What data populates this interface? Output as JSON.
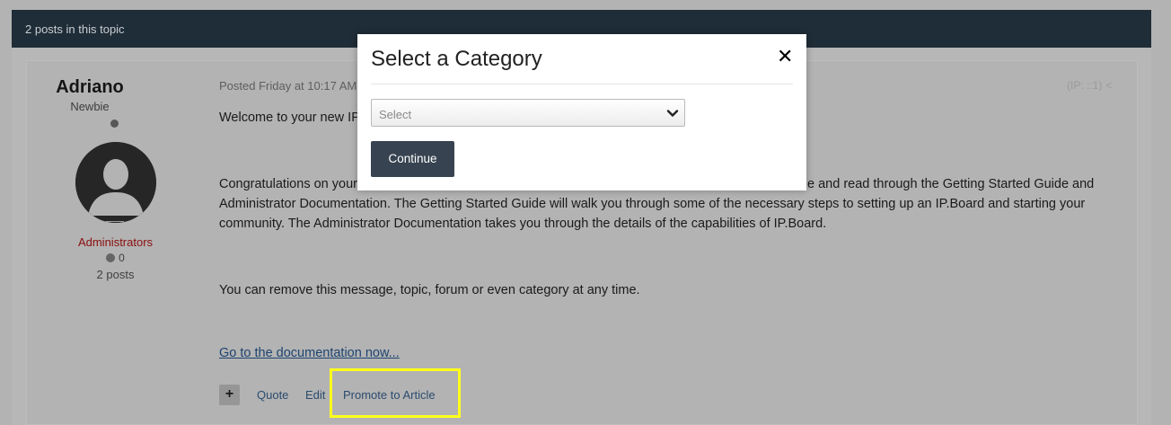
{
  "topic_bar": {
    "text": "2 posts in this topic"
  },
  "author": {
    "name": "Adriano",
    "rank": "Newbie",
    "group": "Administrators",
    "reputation": "0",
    "posts": "2 posts"
  },
  "post": {
    "posted": "Posted Friday at 10:17 AM",
    "ip_label": "(IP: ::1)",
    "para1": "Welcome to your new IPS",
    "para2_left": "Congratulations on your",
    "para2_right": "e and read through the Getting Started Guide and",
    "para2_rest": "Administrator Documentation. The Getting Started Guide will walk you through some of the necessary steps to setting up an IP.Board and starting your community. The Administrator Documentation takes you through the details of the capabilities of IP.Board.",
    "para3": "You can remove this message, topic, forum or even category at any time.",
    "doc_link": "Go to the documentation now..."
  },
  "actions": {
    "plus": "+",
    "quote": "Quote",
    "edit": "Edit",
    "promote": "Promote to Article"
  },
  "modal": {
    "title": "Select a Category",
    "close": "✕",
    "select_value": "Select",
    "continue": "Continue"
  },
  "colors": {
    "highlight": "#ffff1a",
    "topic_bar": "#1f2d38",
    "button": "#374350",
    "group": "#8a0e0e"
  }
}
